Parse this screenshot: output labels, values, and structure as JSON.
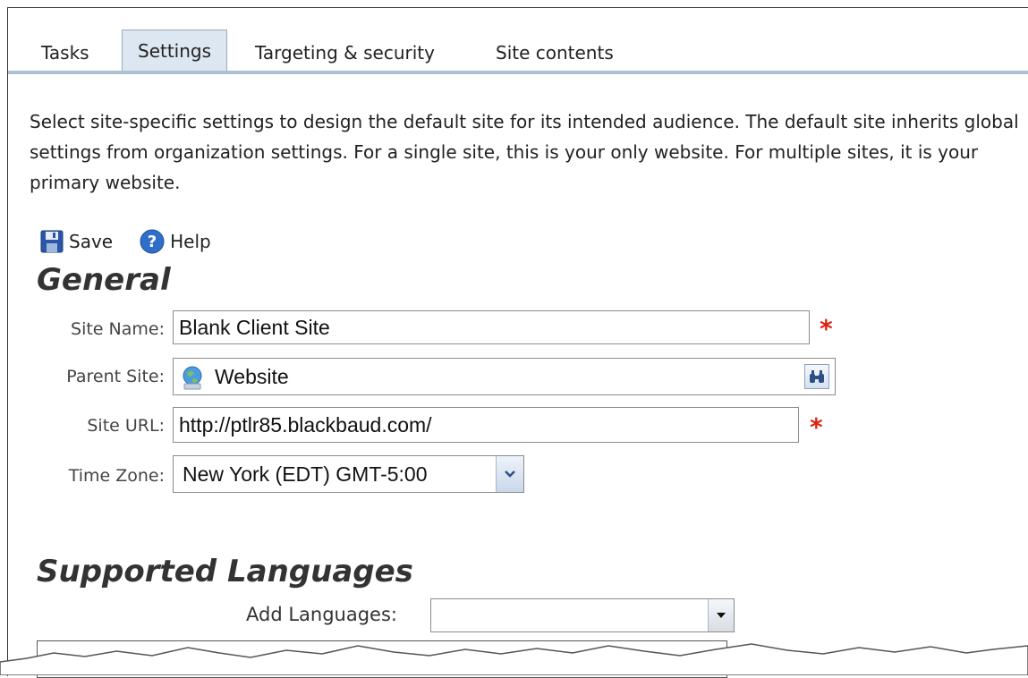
{
  "tabs": [
    {
      "label": "Tasks"
    },
    {
      "label": "Settings"
    },
    {
      "label": "Targeting & security"
    },
    {
      "label": "Site contents"
    }
  ],
  "description": "Select site-specific settings to design the default site for its intended audience. The default site inherits global settings from organization settings. For a single site, this is your only website. For multiple sites, it is your primary website.",
  "toolbar": {
    "save_label": "Save",
    "help_label": "Help"
  },
  "general": {
    "heading": "General",
    "site_name": {
      "label": "Site Name:",
      "value": "Blank Client Site",
      "required_mark": "*"
    },
    "parent_site": {
      "label": "Parent Site:",
      "value": "Website"
    },
    "site_url": {
      "label": "Site URL:",
      "value": "http://ptlr85.blackbaud.com/",
      "required_mark": "*"
    },
    "time_zone": {
      "label": "Time Zone:",
      "value": "New York (EDT) GMT-5:00"
    }
  },
  "languages": {
    "heading": "Supported Languages",
    "add_label": "Add Languages:",
    "add_value": ""
  },
  "colors": {
    "tab_active_bg": "#dde7f1",
    "tab_line": "#aac0d4",
    "required": "#dd2211"
  }
}
